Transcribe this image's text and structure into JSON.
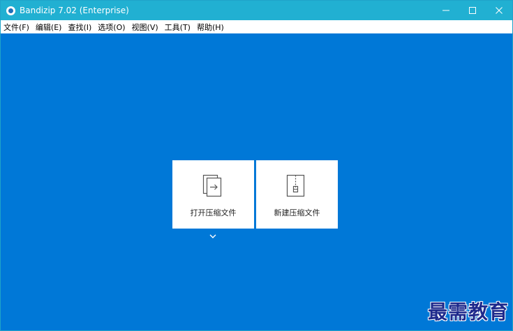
{
  "window": {
    "title": "Bandizip 7.02 (Enterprise)",
    "icon": "bandizip-app-icon",
    "background_color": "#0078d7",
    "titlebar_color": "#21b0d2"
  },
  "controls": {
    "minimize": "minimize-icon",
    "maximize": "maximize-icon",
    "close": "close-icon"
  },
  "menu": {
    "items": [
      {
        "label": "文件(F)"
      },
      {
        "label": "编辑(E)"
      },
      {
        "label": "查找(I)"
      },
      {
        "label": "选项(O)"
      },
      {
        "label": "视图(V)"
      },
      {
        "label": "工具(T)"
      },
      {
        "label": "帮助(H)"
      }
    ]
  },
  "main": {
    "open_archive": {
      "label": "打开压缩文件",
      "icon": "open-archive-icon"
    },
    "new_archive": {
      "label": "新建压缩文件",
      "icon": "zip-file-icon"
    },
    "more": {
      "icon": "chevron-down-icon"
    }
  },
  "watermark": {
    "text": "最需教育"
  }
}
